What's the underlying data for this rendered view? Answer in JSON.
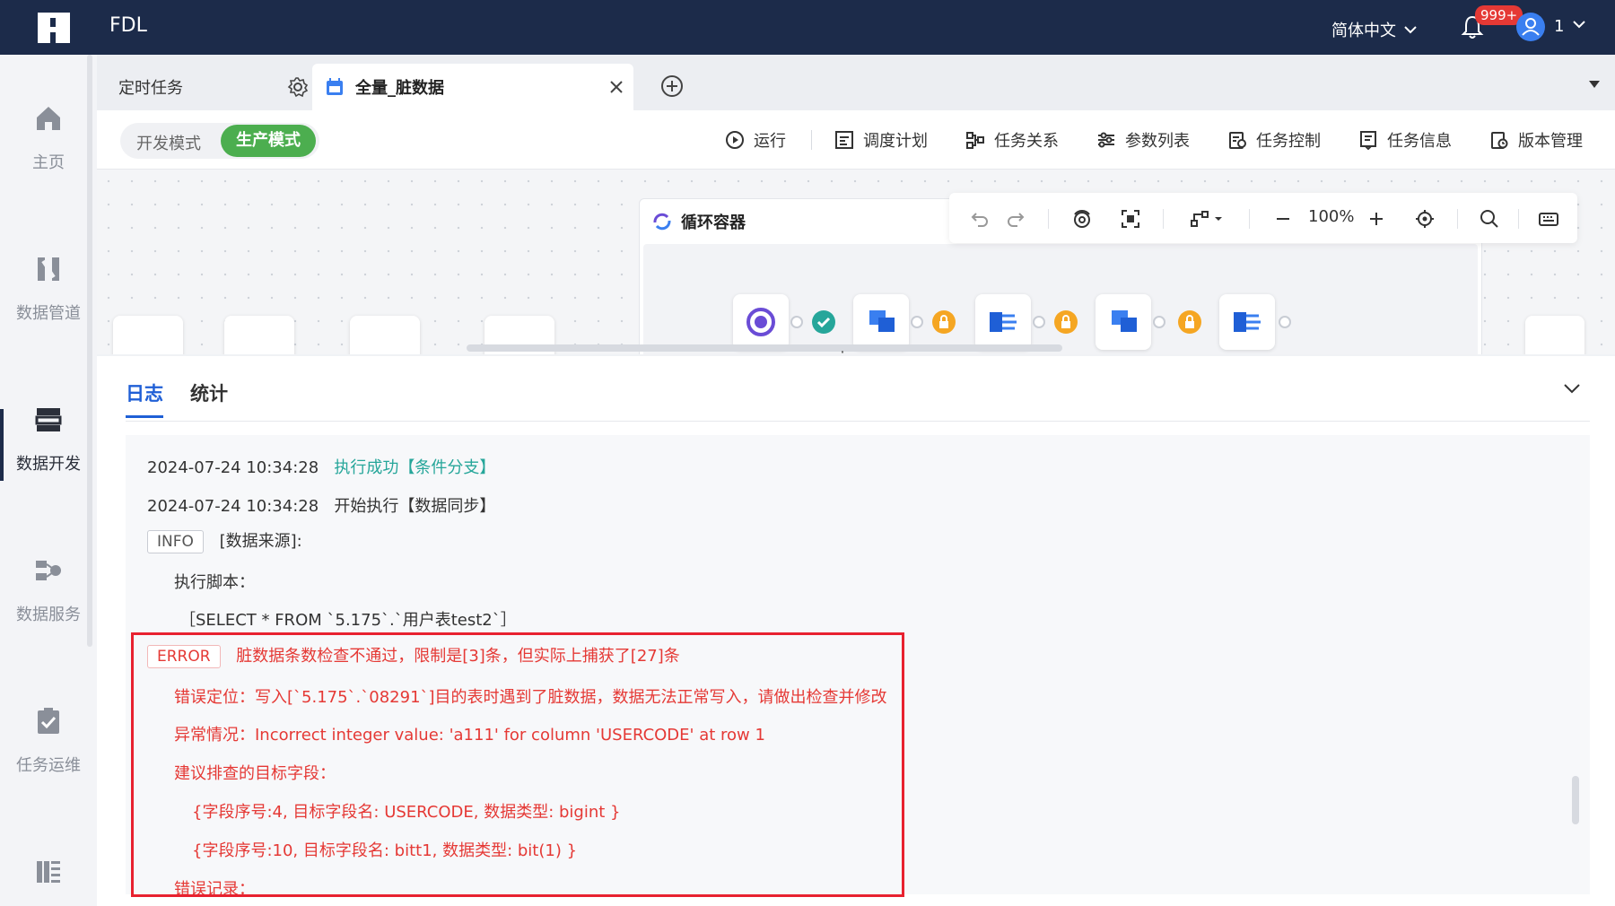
{
  "app": {
    "name": "FDL"
  },
  "header": {
    "language": "简体中文",
    "notification_count": "999+",
    "user_name": "1"
  },
  "sidebar": {
    "items": [
      {
        "label": "主页",
        "icon": "home-icon"
      },
      {
        "label": "数据管道",
        "icon": "pipeline-icon"
      },
      {
        "label": "数据开发",
        "icon": "dev-icon"
      },
      {
        "label": "数据服务",
        "icon": "service-icon"
      },
      {
        "label": "任务运维",
        "icon": "ops-icon"
      },
      {
        "label": "",
        "icon": "more-icon"
      }
    ]
  },
  "tabs": [
    {
      "label": "定时任务"
    },
    {
      "label": "全量_脏数据"
    }
  ],
  "toolbar": {
    "mode_dev": "开发模式",
    "mode_prod": "生产模式",
    "run": "运行",
    "schedule": "调度计划",
    "relation": "任务关系",
    "params": "参数列表",
    "control": "任务控制",
    "info": "任务信息",
    "version": "版本管理"
  },
  "canvas": {
    "container_title": "循环容器",
    "zoom": "100%"
  },
  "panel": {
    "tab_log": "日志",
    "tab_stat": "统计",
    "lines": {
      "l1_time": "2024-07-24 10:34:28",
      "l1_text": "执行成功【条件分支】",
      "l2_time": "2024-07-24 10:34:28",
      "l2_text": "开始执行【数据同步】",
      "l3_tag": "INFO",
      "l3_text": "[数据来源]:",
      "l4_text": "执行脚本：",
      "l5_text": "［SELECT * FROM `5.175`.`用户表test2`］",
      "l6_tag": "ERROR",
      "l6_text": "脏数据条数检查不通过，限制是[3]条，但实际上捕获了[27]条",
      "l7_text": "错误定位：写入[`5.175`.`08291`]目的表时遇到了脏数据，数据无法正常写入，请做出检查并修改",
      "l8_text": "异常情况：Incorrect integer value: 'a111' for column 'USERCODE' at row 1",
      "l9_text": "建议排查的目标字段：",
      "l10_text": "{字段序号:4, 目标字段名: USERCODE, 数据类型: bigint }",
      "l11_text": "{字段序号:10, 目标字段名: bitt1, 数据类型: bit(1) }",
      "l12_text": "错误记录："
    }
  },
  "colors": {
    "topbar": "#1c2b4a",
    "accent": "#1f5fd6",
    "success": "#26a69a",
    "prod_green": "#4cae4f",
    "error": "#e53935",
    "warning": "#f5a623"
  }
}
